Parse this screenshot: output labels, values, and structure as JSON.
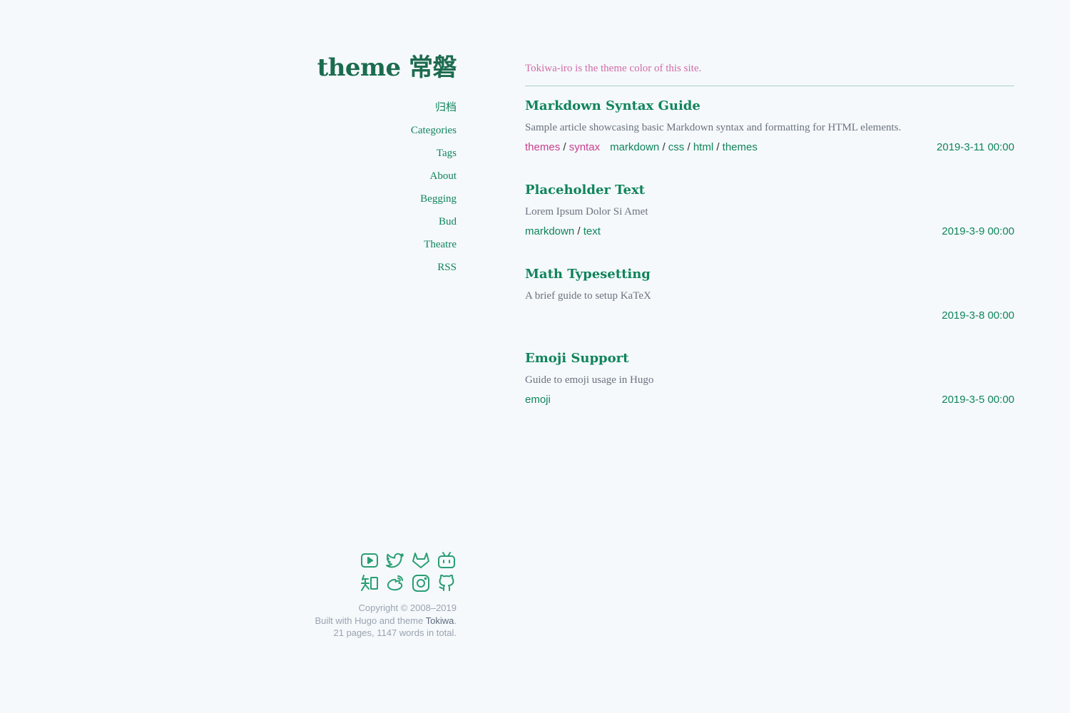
{
  "site": {
    "title": "theme 常磐",
    "tagline": "Tokiwa-iro is the theme color of this site."
  },
  "nav": [
    {
      "label": "归档"
    },
    {
      "label": "Categories"
    },
    {
      "label": "Tags"
    },
    {
      "label": "About"
    },
    {
      "label": "Begging"
    },
    {
      "label": "Bud"
    },
    {
      "label": "Theatre"
    },
    {
      "label": "RSS"
    }
  ],
  "social_icons": {
    "row1": [
      "youtube-icon",
      "twitter-icon",
      "gitlab-icon",
      "bilibili-icon"
    ],
    "row2": [
      "zhihu-icon",
      "weibo-icon",
      "instagram-icon",
      "github-icon"
    ]
  },
  "footer": {
    "copyright": "Copyright © 2008–2019",
    "built_prefix": "Built with Hugo and theme ",
    "theme_link": "Tokiwa",
    "built_suffix": ".",
    "stats": "21 pages, 1147 words in total."
  },
  "posts": [
    {
      "title": "Markdown Syntax Guide",
      "summary": "Sample article showcasing basic Markdown syntax and formatting for HTML elements.",
      "categories": [
        "themes",
        "syntax"
      ],
      "tags": [
        "markdown",
        "css",
        "html",
        "themes"
      ],
      "date": "2019-3-11 00:00"
    },
    {
      "title": "Placeholder Text",
      "summary": "Lorem Ipsum Dolor Si Amet",
      "categories": [],
      "tags": [
        "markdown",
        "text"
      ],
      "date": "2019-3-9 00:00"
    },
    {
      "title": "Math Typesetting",
      "summary": "A brief guide to setup KaTeX",
      "categories": [],
      "tags": [],
      "date": "2019-3-8 00:00"
    },
    {
      "title": "Emoji Support",
      "summary": "Guide to emoji usage in Hugo",
      "categories": [],
      "tags": [
        "emoji"
      ],
      "date": "2019-3-5 00:00"
    }
  ],
  "colors": {
    "background": "#f5f9fb",
    "primary_green": "#10845b",
    "title_green": "#1d6b4f",
    "accent_pink": "#d36ba7",
    "category_pink": "#c93d8f",
    "muted_text": "#6b7280"
  }
}
